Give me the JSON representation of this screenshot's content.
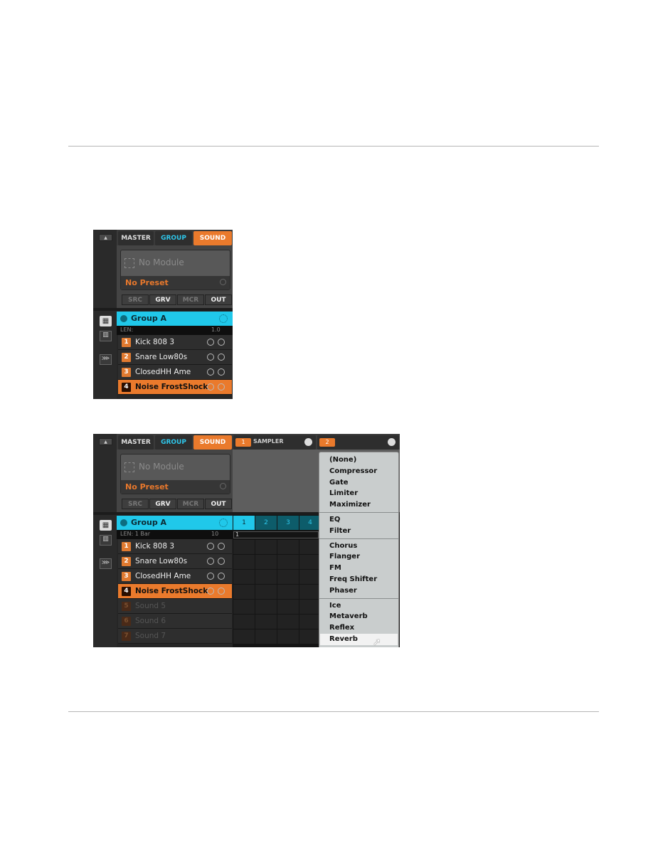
{
  "panels": [
    {
      "tabs": {
        "master": "MASTER",
        "group": "GROUP",
        "sound": "SOUND"
      },
      "module": {
        "name": "No Module",
        "preset": "No Preset"
      },
      "buttons": [
        "SRC",
        "GRV",
        "MCR",
        "OUT"
      ],
      "group": {
        "name": "Group A",
        "len_label": "LEN:",
        "len_value": "",
        "zoom": "1.0"
      },
      "sounds": [
        {
          "num": "1",
          "name": "Kick 808 3"
        },
        {
          "num": "2",
          "name": "Snare Low80s"
        },
        {
          "num": "3",
          "name": "ClosedHH Ame"
        },
        {
          "num": "4",
          "name": "Noise FrostShock",
          "selected": true
        }
      ]
    },
    {
      "tabs": {
        "master": "MASTER",
        "group": "GROUP",
        "sound": "SOUND"
      },
      "module": {
        "name": "No Module",
        "preset": "No Preset"
      },
      "buttons": [
        "SRC",
        "GRV",
        "MCR",
        "OUT"
      ],
      "group": {
        "name": "Group A",
        "len_label": "LEN: 1 Bar",
        "len_value": "",
        "zoom": "10"
      },
      "sounds": [
        {
          "num": "1",
          "name": "Kick 808 3"
        },
        {
          "num": "2",
          "name": "Snare Low80s"
        },
        {
          "num": "3",
          "name": "ClosedHH Ame"
        },
        {
          "num": "4",
          "name": "Noise FrostShock",
          "selected": true
        },
        {
          "num": "5",
          "name": "Sound 5",
          "empty": true
        },
        {
          "num": "6",
          "name": "Sound 6",
          "empty": true
        },
        {
          "num": "7",
          "name": "Sound 7",
          "empty": true
        }
      ],
      "slots": [
        {
          "num": "1",
          "name": "SAMPLER"
        },
        {
          "num": "2",
          "name": ""
        }
      ],
      "pattern": {
        "pads": [
          "1",
          "2",
          "3",
          "4"
        ],
        "position": "1"
      },
      "menu": {
        "sections": [
          [
            "(None)",
            "Compressor",
            "Gate",
            "Limiter",
            "Maximizer"
          ],
          [
            "EQ",
            "Filter"
          ],
          [
            "Chorus",
            "Flanger",
            "FM",
            "Freq Shifter",
            "Phaser"
          ],
          [
            "Ice",
            "Metaverb",
            "Reflex",
            "Reverb"
          ]
        ],
        "highlighted": "Reverb"
      }
    }
  ],
  "colors": {
    "accent_orange": "#e87a2e",
    "accent_cyan": "#20c8ea",
    "menu_bg": "#c9cdcd"
  }
}
